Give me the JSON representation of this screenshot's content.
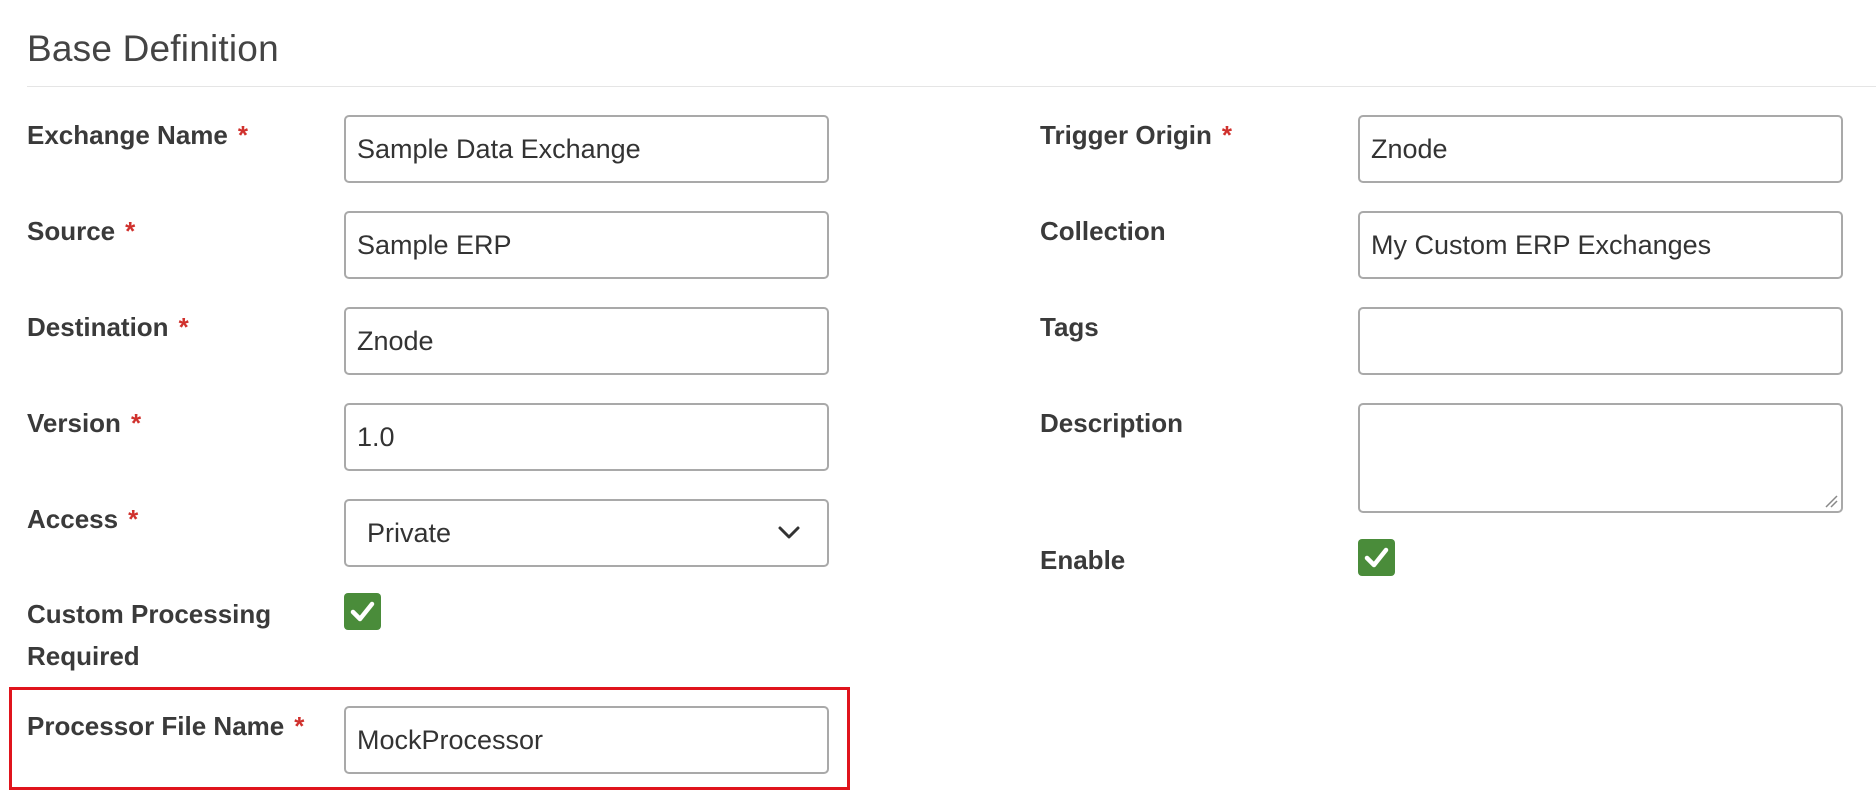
{
  "section": {
    "title": "Base Definition"
  },
  "required_marker": "*",
  "left_fields": {
    "exchange_name": {
      "label": "Exchange Name",
      "value": "Sample Data Exchange"
    },
    "source": {
      "label": "Source",
      "value": "Sample ERP"
    },
    "destination": {
      "label": "Destination",
      "value": "Znode"
    },
    "version": {
      "label": "Version",
      "value": "1.0"
    },
    "access": {
      "label": "Access",
      "value": "Private"
    },
    "custom_processing": {
      "label_line1": "Custom Processing",
      "label_line2": "Required",
      "checked": true
    },
    "processor_file_name": {
      "label": "Processor File Name",
      "value": "MockProcessor"
    }
  },
  "right_fields": {
    "trigger_origin": {
      "label": "Trigger Origin",
      "value": "Znode"
    },
    "collection": {
      "label": "Collection",
      "value": "My Custom ERP Exchanges"
    },
    "tags": {
      "label": "Tags",
      "value": ""
    },
    "description": {
      "label": "Description",
      "value": ""
    },
    "enable": {
      "label": "Enable",
      "checked": true
    }
  },
  "colors": {
    "required": "#d0312d",
    "checkbox": "#4a8c3a",
    "highlight": "#e0141c",
    "input_border": "#a9a9a9"
  },
  "icons": {
    "dropdown": "chevron-down-icon",
    "checkbox_mark": "checkmark-icon"
  }
}
